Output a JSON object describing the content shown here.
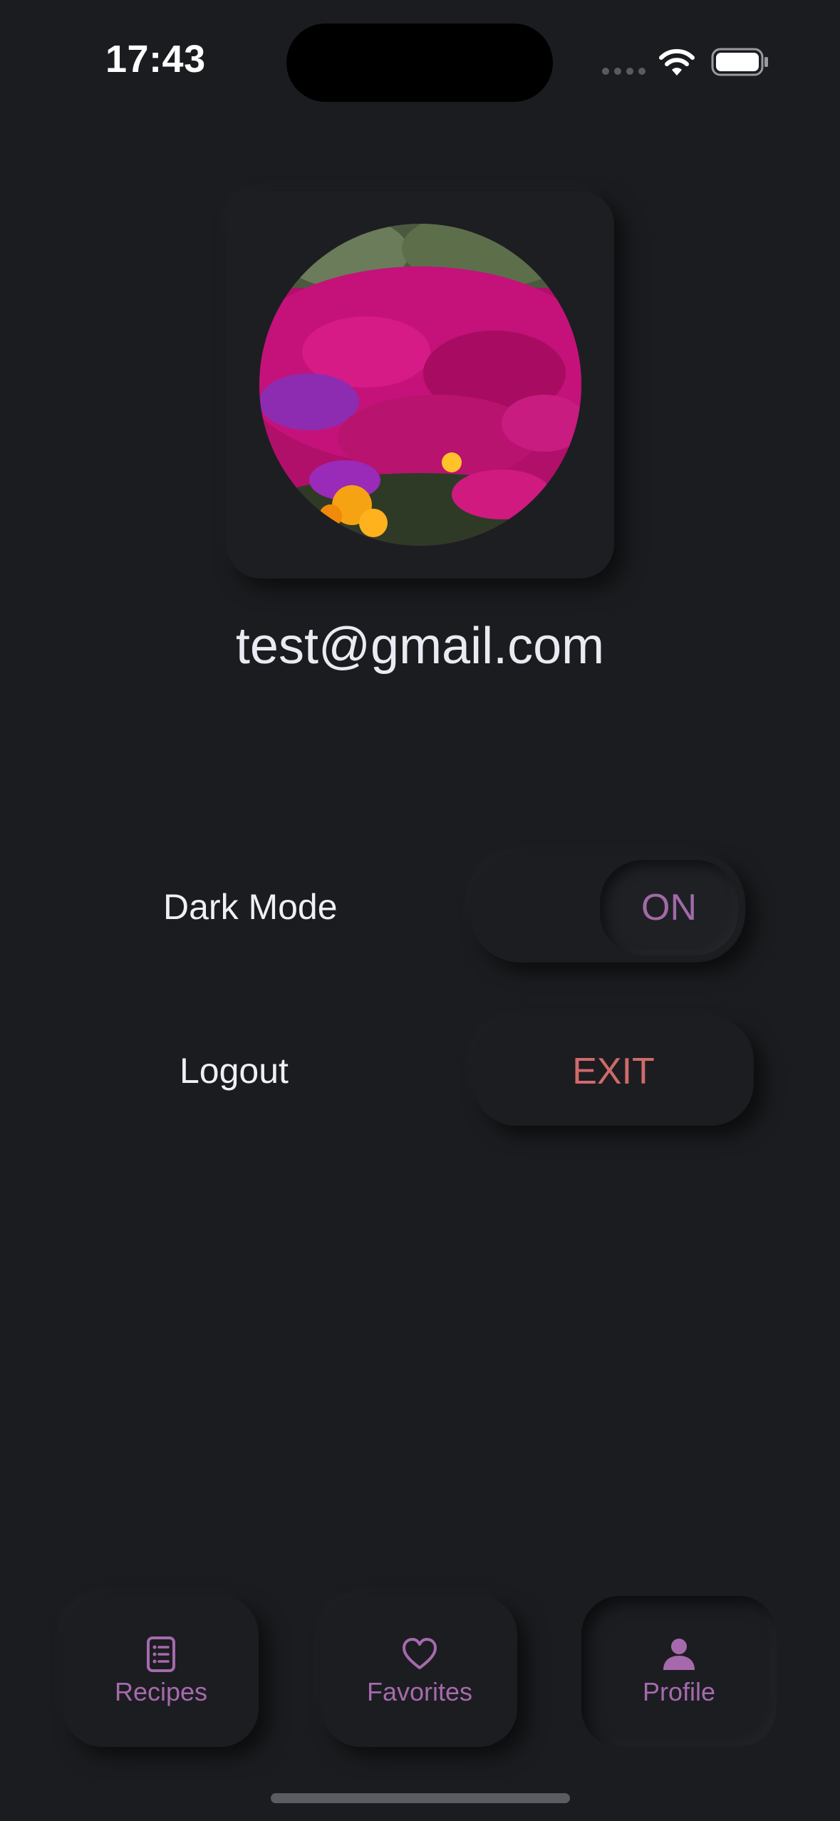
{
  "status_bar": {
    "time": "17:43"
  },
  "profile": {
    "email": "test@gmail.com",
    "avatar_description": "pink-flower-field-photo"
  },
  "settings": {
    "dark_mode": {
      "label": "Dark Mode",
      "value": "ON"
    },
    "logout": {
      "label": "Logout",
      "button_label": "EXIT"
    }
  },
  "tab_bar": {
    "tabs": [
      {
        "label": "Recipes",
        "icon": "recipe-book-icon",
        "active": false
      },
      {
        "label": "Favorites",
        "icon": "heart-icon",
        "active": false
      },
      {
        "label": "Profile",
        "icon": "person-icon",
        "active": true
      }
    ]
  },
  "colors": {
    "background": "#1b1c1f",
    "accent": "#a66aac",
    "danger": "#d06a6a",
    "text": "#e8ebf2"
  }
}
